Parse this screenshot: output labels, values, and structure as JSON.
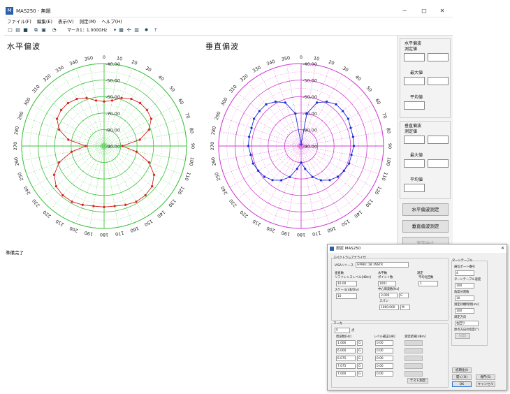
{
  "window": {
    "title": "MAS250 - 無題",
    "minimize": "─",
    "maximize": "□",
    "close": "✕"
  },
  "menu": [
    "ファイル(F)",
    "編集(E)",
    "表示(V)",
    "測定(M)",
    "ヘルプ(H)"
  ],
  "toolbar": {
    "marker_label": "マーカ1：1.000GHz",
    "icons": [
      "new-icon",
      "open-icon",
      "save-icon",
      "copy-icon",
      "paste-icon",
      "print-icon",
      "grid-icon",
      "network-icon",
      "chart-icon",
      "settings-icon",
      "help-icon"
    ]
  },
  "plots": {
    "horizontal_title": "水平偏波",
    "vertical_title": "垂直偏波",
    "radial_labels": [
      "-40.00",
      "-50.00",
      "-60.00",
      "-70.00",
      "-80.00",
      "-90.00"
    ]
  },
  "chart_data": [
    {
      "type": "polar",
      "title": "水平偏波",
      "angular_ticks_deg": [
        0,
        10,
        20,
        30,
        40,
        50,
        60,
        70,
        80,
        90,
        100,
        110,
        120,
        130,
        140,
        150,
        160,
        170,
        180,
        190,
        200,
        210,
        220,
        230,
        240,
        250,
        260,
        270,
        280,
        290,
        300,
        310,
        320,
        330,
        340,
        350
      ],
      "radial_ticks": [
        -40,
        -50,
        -60,
        -70,
        -80,
        -90
      ],
      "rlim": [
        -90,
        -40
      ],
      "series": [
        {
          "color": "#d62020",
          "angles_deg": [
            0,
            10,
            20,
            30,
            40,
            50,
            60,
            70,
            80,
            90,
            100,
            110,
            120,
            130,
            140,
            150,
            160,
            170,
            180,
            190,
            200,
            210,
            220,
            230,
            240,
            250,
            260,
            270,
            280,
            290,
            300,
            310,
            320,
            330,
            340,
            350
          ],
          "values": [
            -63,
            -62,
            -59,
            -57,
            -56,
            -56,
            -57,
            -61,
            -68,
            -79,
            -70,
            -61,
            -55,
            -52,
            -51,
            -51,
            -52,
            -53,
            -53,
            -53,
            -52,
            -51,
            -51,
            -52,
            -55,
            -61,
            -70,
            -79,
            -68,
            -61,
            -57,
            -56,
            -56,
            -57,
            -59,
            -62
          ]
        }
      ]
    },
    {
      "type": "polar",
      "title": "垂直偏波",
      "angular_ticks_deg": [
        0,
        10,
        20,
        30,
        40,
        50,
        60,
        70,
        80,
        90,
        100,
        110,
        120,
        130,
        140,
        150,
        160,
        170,
        180,
        190,
        200,
        210,
        220,
        230,
        240,
        250,
        260,
        270,
        280,
        290,
        300,
        310,
        320,
        330,
        340,
        350
      ],
      "radial_ticks": [
        -40,
        -50,
        -60,
        -70,
        -80,
        -90
      ],
      "rlim": [
        -90,
        -40
      ],
      "series": [
        {
          "color": "#1a2bd6",
          "angles_deg": [
            0,
            10,
            20,
            30,
            40,
            50,
            60,
            70,
            80,
            90,
            100,
            110,
            120,
            130,
            140,
            150,
            160,
            170,
            180,
            190,
            200,
            210,
            220,
            230,
            240,
            250,
            260,
            270,
            280,
            290,
            300,
            310,
            320,
            330,
            340,
            350
          ],
          "values": [
            -89,
            -70,
            -62,
            -59,
            -57,
            -57,
            -57,
            -58,
            -58,
            -58,
            -59,
            -59,
            -60,
            -61,
            -63,
            -66,
            -70,
            -76,
            -80,
            -76,
            -70,
            -66,
            -63,
            -61,
            -60,
            -59,
            -59,
            -58,
            -58,
            -58,
            -57,
            -57,
            -57,
            -59,
            -62,
            -70
          ]
        }
      ]
    }
  ],
  "side": {
    "h_group": "水平偏波",
    "measured": "測定値",
    "max": "最大値",
    "avg": "平均値",
    "v_group": "垂直偏波",
    "btn_h": "水平偏波測定",
    "btn_v": "垂直偏波測定",
    "btn_partial": "測定中止"
  },
  "status": "準備完了",
  "dialog": {
    "title": "設定 MAS250",
    "spectrum_group": "スペクトラムアナライザ",
    "visa_label": "VISAリソース",
    "visa_value": "GPIB0::18::INSTR",
    "vertical_axis": "垂直軸",
    "ref_level_label": "リファレンスレベル[dBm]",
    "ref_level": "10.00",
    "scale_label": "スケール[dB/Div]",
    "scale": "10",
    "horizontal_axis": "水平軸",
    "points_label": "ポイント数",
    "points": "1001",
    "center_label": "中心周波数[Hz]",
    "center": "3.000",
    "center_unit": "G",
    "span_label": "スパン",
    "span": "1000.000",
    "span_unit": "M",
    "measure_label": "測定",
    "avg_count_label": "平均化回数",
    "avg_count": "1",
    "marker_group": "マーカ",
    "marker_count": "5",
    "marker_unit": "点",
    "freq_col": "周波数[Hz]",
    "level_col": "レベル補正[dB]",
    "result_col": "測定結果[dBm]",
    "markers": [
      {
        "freq": "1.000",
        "unit": "G",
        "level": "0.00"
      },
      {
        "freq": "6.000",
        "unit": "G",
        "level": "0.00"
      },
      {
        "freq": "6.075",
        "unit": "G",
        "level": "0.00"
      },
      {
        "freq": "7.075",
        "unit": "G",
        "level": "0.00"
      },
      {
        "freq": "7.000",
        "unit": "G",
        "level": "0.00"
      }
    ],
    "test_button": "テスト測定",
    "turntable_group": "ターンテーブル",
    "port_label": "通信ポート番号",
    "port": "4",
    "speed_label": "ターンテーブル速度",
    "speed": "100",
    "angle_label": "角度分割数",
    "angle": "10",
    "wait_label": "測定待機時間[ms]",
    "wait": "100",
    "dir_label": "測定方向",
    "dir": "右回り",
    "origin_label": "原点方向の指定(°)",
    "origin": "0(度)",
    "btn_init": "初期化(I)",
    "btn_open": "開く(O)",
    "btn_save": "保存(S)",
    "btn_ok": "OK",
    "btn_cancel": "キャンセル"
  }
}
